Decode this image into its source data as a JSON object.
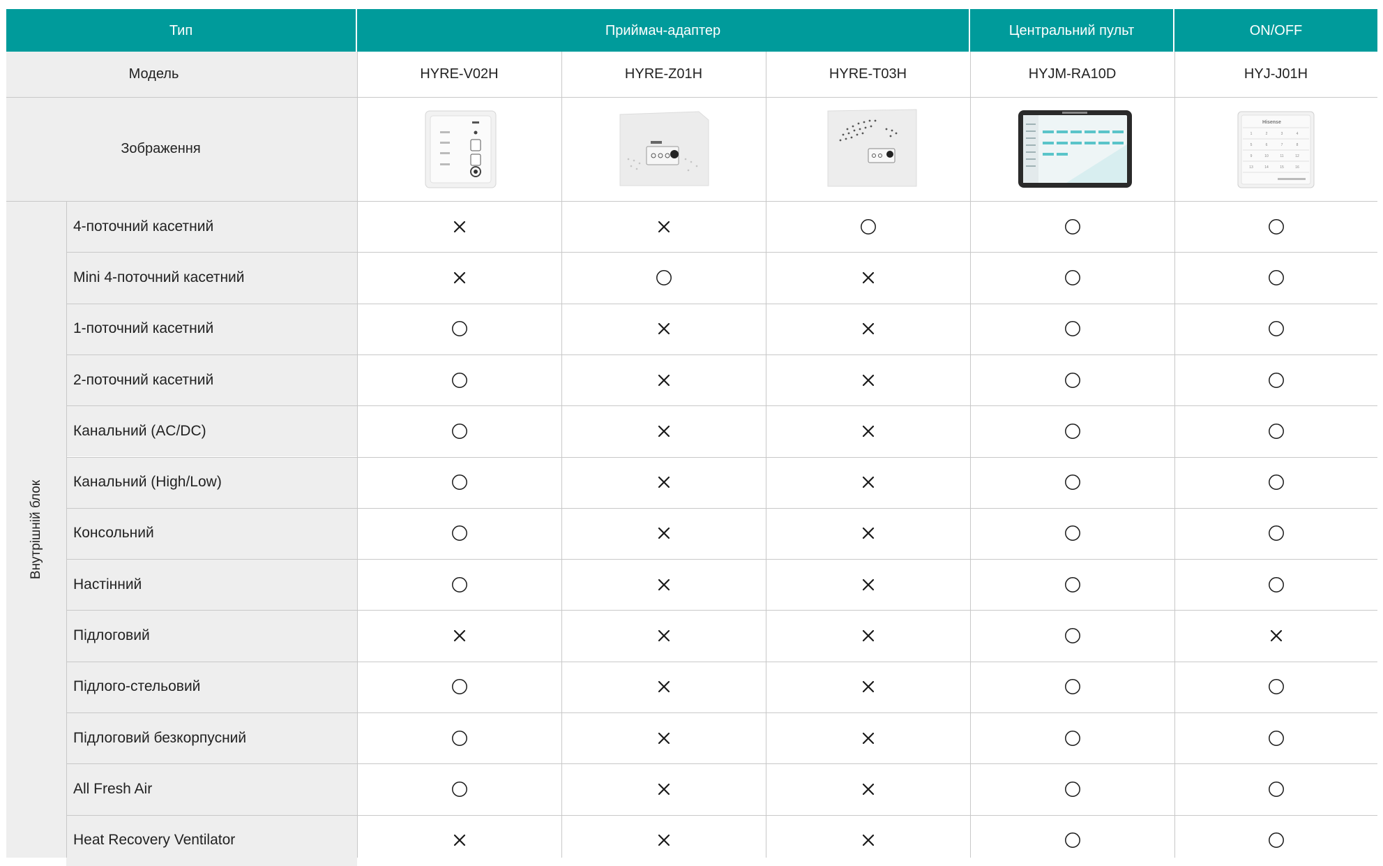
{
  "header": {
    "type_label": "Тип",
    "group_adapter": "Приймач-адаптер",
    "group_central": "Центральний пульт",
    "group_onoff": "ON/OFF"
  },
  "model_row": {
    "label": "Модель",
    "models": [
      "HYRE-V02H",
      "HYRE-Z01H",
      "HYRE-T03H",
      "HYJM-RA10D",
      "HYJ-J01H"
    ]
  },
  "image_row": {
    "label": "Зображення",
    "images": [
      "hyre-v02h-device",
      "hyre-z01h-device",
      "hyre-t03h-device",
      "hyjm-ra10d-touch-panel",
      "hyj-j01h-keypad"
    ],
    "panel_brand": "Hisense"
  },
  "section_label": "Внутрішній блок",
  "rows": [
    {
      "label": "4-поточний касетний",
      "marks": [
        "x",
        "x",
        "o",
        "o",
        "o"
      ]
    },
    {
      "label": "Mini 4-поточний касетний",
      "marks": [
        "x",
        "o",
        "x",
        "o",
        "o"
      ]
    },
    {
      "label": "1-поточний касетний",
      "marks": [
        "o",
        "x",
        "x",
        "o",
        "o"
      ]
    },
    {
      "label": "2-поточний касетний",
      "marks": [
        "o",
        "x",
        "x",
        "o",
        "o"
      ]
    },
    {
      "label": "Канальний (AC/DC)",
      "marks": [
        "o",
        "x",
        "x",
        "o",
        "o"
      ]
    },
    {
      "label": "Канальний (High/Low)",
      "marks": [
        "o",
        "x",
        "x",
        "o",
        "o"
      ]
    },
    {
      "label": "Консольний",
      "marks": [
        "o",
        "x",
        "x",
        "o",
        "o"
      ]
    },
    {
      "label": "Настінний",
      "marks": [
        "o",
        "x",
        "x",
        "o",
        "o"
      ]
    },
    {
      "label": "Підлоговий",
      "marks": [
        "x",
        "x",
        "x",
        "o",
        "x"
      ]
    },
    {
      "label": "Підлого-стельовий",
      "marks": [
        "o",
        "x",
        "x",
        "o",
        "o"
      ]
    },
    {
      "label": "Підлоговий безкорпусний",
      "marks": [
        "o",
        "x",
        "x",
        "o",
        "o"
      ]
    },
    {
      "label": "All Fresh Air",
      "marks": [
        "o",
        "x",
        "x",
        "o",
        "o"
      ]
    },
    {
      "label": "Heat Recovery Ventilator",
      "marks": [
        "x",
        "x",
        "x",
        "o",
        "o"
      ]
    }
  ],
  "colors": {
    "header_bg": "#009b9b",
    "label_bg": "#eeeeee",
    "grid_line": "#c8c8c8"
  }
}
